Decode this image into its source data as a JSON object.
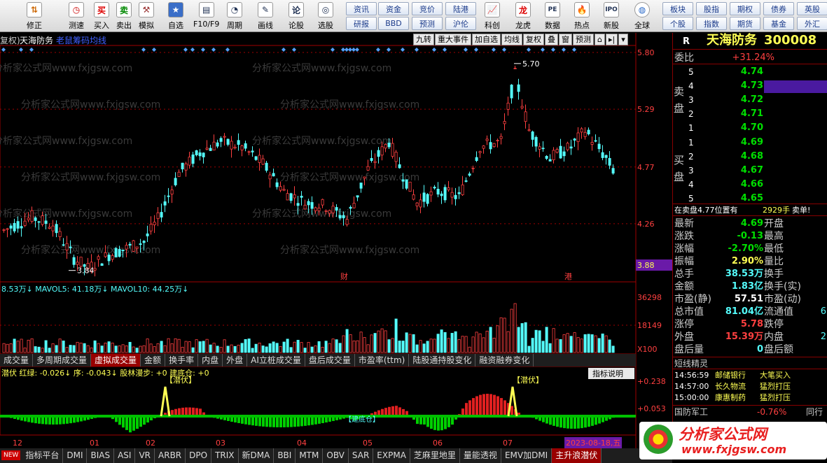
{
  "toolbar": {
    "buttons": [
      {
        "label": "修正",
        "icon": "up-down-arrows-icon"
      },
      {
        "label": "测速",
        "icon": "clock-icon"
      },
      {
        "label": "买入",
        "icon": "buy-icon",
        "glyph": "买"
      },
      {
        "label": "卖出",
        "icon": "sell-icon",
        "glyph": "卖"
      },
      {
        "label": "模拟",
        "icon": "hammer-icon"
      },
      {
        "label": "自选",
        "icon": "star-icon"
      },
      {
        "label": "F10/F9",
        "icon": "f10-icon"
      },
      {
        "label": "周期",
        "icon": "period-icon"
      },
      {
        "label": "画线",
        "icon": "pen-icon"
      },
      {
        "label": "论股",
        "icon": "forum-icon"
      },
      {
        "label": "选股",
        "icon": "select-stock-icon"
      },
      {
        "label": "科创",
        "icon": "chart-icon"
      },
      {
        "label": "龙虎",
        "icon": "dragon-icon"
      },
      {
        "label": "数据",
        "icon": "pe-icon"
      },
      {
        "label": "热点",
        "icon": "fire-icon"
      },
      {
        "label": "新股",
        "icon": "ipo-icon"
      },
      {
        "label": "全球",
        "icon": "globe-icon"
      }
    ],
    "top_tabs": [
      "资讯",
      "资金",
      "竞价",
      "陆港",
      "研报",
      "BBD",
      "预测",
      "沪伦",
      "板块",
      "股指",
      "期权",
      "债券",
      "英股",
      "个股",
      "指数",
      "期货",
      "基金",
      "外汇"
    ]
  },
  "chart": {
    "left_title": "复权)",
    "stock_name": "天海防务",
    "indicator_name": "老鼠筹码均线",
    "signal_tabs": [
      "九转",
      "重大事件",
      "加自选",
      "均线",
      "复权",
      "叠",
      "窗",
      "预测"
    ],
    "price_axis": [
      "5.80",
      "5.29",
      "4.77",
      "4.26",
      "3.88"
    ],
    "high_label": "5.70",
    "low_label": "3.84",
    "event_labels": [
      "财",
      "港"
    ],
    "volume_line": "8.53万↓  MAVOL5: 41.18万↓  MAVOL10: 44.25万↓",
    "volume_axis": [
      "36298",
      "18149",
      "X100"
    ],
    "watermark": "分析家公式网www.fxjgsw.com",
    "indicator_line": "潜伏 红绿: -0.026↓ 序: -0.043↓ 股林漫步: +0 建底仓: +0",
    "indicator_axis": [
      "+0.238",
      "+0.053"
    ],
    "indicator_help": "指标说明",
    "sub_labels": [
      "【潜伏】",
      "【潜伏】",
      "【建底仓】"
    ],
    "date_axis": [
      "12",
      "01",
      "02",
      "03",
      "04",
      "05",
      "06",
      "07"
    ],
    "date_badge": "2023-08-18,五"
  },
  "func_tabs": [
    "成交量",
    "多周期成交量",
    "虚拟成交量",
    "金额",
    "换手率",
    "内盘",
    "外盘",
    "AI立桩成交量",
    "盘后成交量",
    "市盈率(ttm)",
    "陆股通持股变化",
    "融资融券变化"
  ],
  "func_tab_active": "虚拟成交量",
  "bottom_tabs": [
    "指标平台",
    "DMI",
    "BIAS",
    "ASI",
    "VR",
    "ARBR",
    "DPO",
    "TRIX",
    "新DMA",
    "BBI",
    "MTM",
    "OBV",
    "SAR",
    "EXPMA",
    "芝麻里地里",
    "量能透视",
    "EMV加DMI",
    "主升浪潜伏"
  ],
  "bottom_tab_active": "主升浪潜伏",
  "new_badge": "NEW",
  "quote": {
    "flag": "R",
    "name": "天海防务",
    "code": "300008",
    "weibi_label": "委比",
    "weibi": "+31.24%",
    "sell_side_label": "卖盘",
    "buy_side_label": "买盘",
    "sell": [
      [
        "5",
        "4.74"
      ],
      [
        "4",
        "4.73"
      ],
      [
        "3",
        "4.72"
      ],
      [
        "2",
        "4.71"
      ],
      [
        "1",
        "4.70"
      ]
    ],
    "buy": [
      [
        "1",
        "4.69"
      ],
      [
        "2",
        "4.68"
      ],
      [
        "3",
        "4.67"
      ],
      [
        "4",
        "4.66"
      ],
      [
        "5",
        "4.65"
      ]
    ],
    "inline_msg": "在卖盘4.77位置有",
    "inline_qty": "2929手",
    "inline_tail": "卖单!",
    "stats": [
      [
        "最新",
        "4.69",
        "开盘",
        ""
      ],
      [
        "涨跌",
        "-0.13",
        "最高",
        ""
      ],
      [
        "涨幅",
        "-2.70%",
        "最低",
        ""
      ],
      [
        "振幅",
        "2.90%",
        "量比",
        ""
      ],
      [
        "总手",
        "38.53万",
        "换手",
        ""
      ],
      [
        "金额",
        "1.83亿",
        "换手(实)",
        ""
      ],
      [
        "市盈(静)",
        "57.51",
        "市盈(动)",
        ""
      ],
      [
        "总市值",
        "81.04亿",
        "流通值",
        "6"
      ],
      [
        "涨停",
        "5.78",
        "跌停",
        ""
      ],
      [
        "外盘",
        "15.39万",
        "内盘",
        "2"
      ],
      [
        "盘后量",
        "0",
        "盘后额",
        ""
      ]
    ],
    "sprite_title": "短线精灵",
    "sprites": [
      [
        "14:56:59",
        "邮储银行",
        "大笔买入"
      ],
      [
        "14:57:00",
        "长久物流",
        "猛烈打压"
      ],
      [
        "15:00:00",
        "康惠制药",
        "猛烈打压"
      ]
    ],
    "sector_name": "国防军工",
    "sector_chg": "-0.76%",
    "sector_tail": "同行"
  },
  "logo": {
    "name": "分析家公式网",
    "url": "www.fxjgsw.com"
  },
  "colors": {
    "up": "#ff4040",
    "down": "#54fcfc",
    "green": "#00e000",
    "yellow": "#ffff54",
    "axis_red": "#a00000"
  }
}
